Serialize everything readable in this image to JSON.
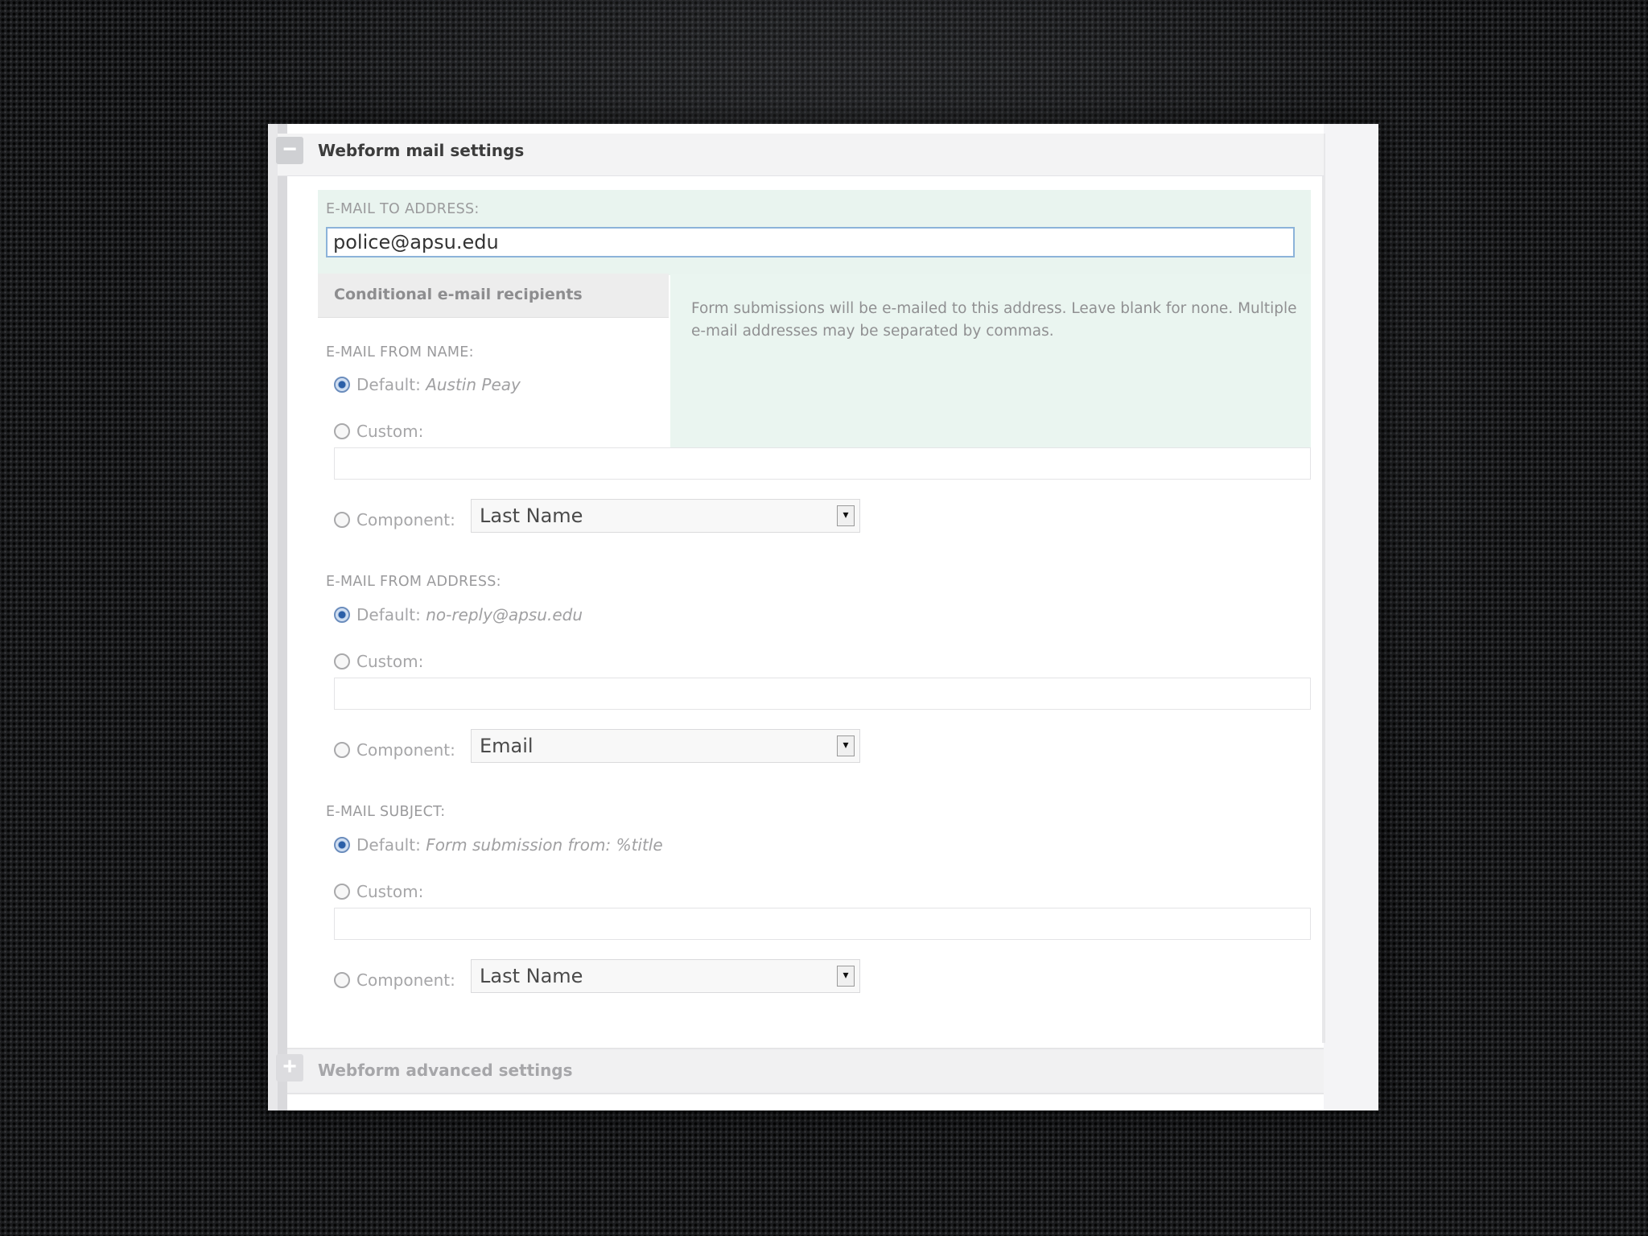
{
  "mail_settings": {
    "legend": "Webform mail settings",
    "toggle_collapse": "−",
    "email_to": {
      "label": "E-MAIL TO ADDRESS:",
      "value": "police@apsu.edu"
    },
    "conditional_tab": "Conditional e-mail recipients",
    "description": "Form submissions will be e-mailed to this address. Leave blank for none. Multiple e-mail addresses may be separated by commas.",
    "from_name": {
      "label": "E-MAIL FROM NAME:",
      "default_label": "Default:",
      "default_value": "Austin Peay",
      "custom_label": "Custom:",
      "component_label": "Component:",
      "component_selected": "Last Name"
    },
    "from_address": {
      "label": "E-MAIL FROM ADDRESS:",
      "default_label": "Default:",
      "default_value": "no-reply@apsu.edu",
      "custom_label": "Custom:",
      "component_label": "Component:",
      "component_selected": "Email"
    },
    "subject": {
      "label": "E-MAIL SUBJECT:",
      "default_label": "Default:",
      "default_value": "Form submission from: %title",
      "custom_label": "Custom:",
      "component_label": "Component:",
      "component_selected": "Last Name"
    }
  },
  "advanced_settings": {
    "legend": "Webform advanced settings",
    "toggle_expand": "+"
  },
  "icons": {
    "collapse": "minus-icon",
    "expand": "plus-icon",
    "dropdown": "dropdown-arrow-icon"
  },
  "colors": {
    "highlight_bg": "#e9f4ef",
    "focus_border": "#8cb3d9",
    "radio_checked": "#2b5fa8"
  }
}
